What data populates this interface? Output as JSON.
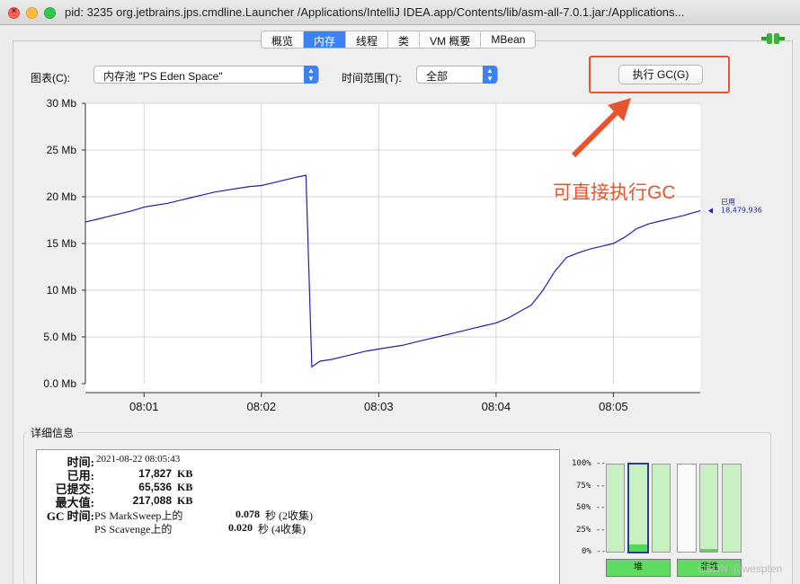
{
  "window": {
    "title": "pid: 3235 org.jetbrains.jps.cmdline.Launcher /Applications/IntelliJ IDEA.app/Contents/lib/asm-all-7.0.1.jar:/Applications..."
  },
  "tabs": [
    {
      "label": "概览",
      "active": false
    },
    {
      "label": "内存",
      "active": true
    },
    {
      "label": "线程",
      "active": false
    },
    {
      "label": "类",
      "active": false
    },
    {
      "label": "VM 概要",
      "active": false
    },
    {
      "label": "MBean",
      "active": false
    }
  ],
  "controls": {
    "chart_label": "图表(C):",
    "chart_select": "内存池 \"PS Eden Space\"",
    "range_label": "时间范围(T):",
    "range_select": "全部",
    "gc_button": "执行 GC(G)"
  },
  "annotation": "可直接执行GC",
  "chart_data": {
    "type": "line",
    "y_ticks": [
      "30 Mb",
      "25 Mb",
      "20 Mb",
      "15 Mb",
      "10 Mb",
      "5.0 Mb",
      "0.0 Mb"
    ],
    "x_ticks": [
      "08:01",
      "08:02",
      "08:03",
      "08:04",
      "08:05"
    ],
    "ylim": [
      0,
      30
    ],
    "xlim": [
      0.5,
      5.74
    ],
    "x_tick_values": [
      1,
      2,
      3,
      4,
      5
    ],
    "x_unit": "minutes after 08:00",
    "y_unit": "Mb",
    "line_color": "#1f1fb4",
    "series": [
      {
        "name": "已用",
        "last_value": "18,479,936",
        "x": [
          0.5,
          0.6,
          0.7,
          0.8,
          0.9,
          1.0,
          1.1,
          1.2,
          1.3,
          1.4,
          1.5,
          1.6,
          1.7,
          1.8,
          1.9,
          2.0,
          2.1,
          2.2,
          2.3,
          2.38,
          2.43,
          2.5,
          2.6,
          2.7,
          2.8,
          2.9,
          3.0,
          3.1,
          3.2,
          3.3,
          3.4,
          3.5,
          3.6,
          3.7,
          3.8,
          3.9,
          4.0,
          4.1,
          4.2,
          4.3,
          4.4,
          4.5,
          4.6,
          4.7,
          4.8,
          4.9,
          5.0,
          5.1,
          5.2,
          5.3,
          5.4,
          5.5,
          5.6,
          5.74
        ],
        "y": [
          17.3,
          17.6,
          17.9,
          18.2,
          18.5,
          18.9,
          19.1,
          19.3,
          19.6,
          19.9,
          20.2,
          20.5,
          20.7,
          20.9,
          21.1,
          21.2,
          21.5,
          21.8,
          22.1,
          22.3,
          1.8,
          2.4,
          2.6,
          2.9,
          3.2,
          3.5,
          3.7,
          3.9,
          4.1,
          4.4,
          4.7,
          5.0,
          5.3,
          5.6,
          5.9,
          6.2,
          6.5,
          7.0,
          7.7,
          8.4,
          10.0,
          12.0,
          13.5,
          14.0,
          14.4,
          14.7,
          15.0,
          15.7,
          16.6,
          17.1,
          17.4,
          17.7,
          18.0,
          18.5
        ]
      }
    ]
  },
  "details": {
    "legend": "详细信息",
    "time_label": "时间:",
    "time_value": "2021-08-22 08:05:43",
    "used_label": "已用:",
    "used_value": "17,827",
    "used_unit": "KB",
    "committed_label": "已提交:",
    "committed_value": "65,536",
    "committed_unit": "KB",
    "max_label": "最大值:",
    "max_value": "217,088",
    "max_unit": "KB",
    "gc_label": "GC 时间:",
    "gc_rows": [
      {
        "name": "PS MarkSweep上的",
        "value": "0.078",
        "unit": "秒 (2收集)"
      },
      {
        "name": "PS Scavenge上的",
        "value": "0.020",
        "unit": "秒 (4收集)"
      }
    ]
  },
  "bars": {
    "pct_ticks": [
      "100% --",
      "75% --",
      "50% --",
      "25% --",
      "0% --"
    ],
    "values": [
      0.0,
      0.08,
      0.0,
      0.0,
      0.03,
      0.0
    ],
    "heap_label": "堆",
    "nonheap_label": "非堆"
  },
  "watermark": "CSDN @wespten"
}
